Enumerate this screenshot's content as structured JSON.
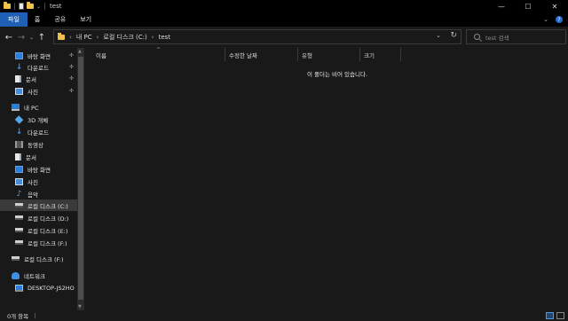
{
  "window": {
    "title": "test",
    "controls": {
      "minimize": "—",
      "maximize": "☐",
      "close": "✕"
    }
  },
  "ribbon": {
    "tabs": [
      {
        "label": "파일",
        "active": true
      },
      {
        "label": "홈",
        "active": false
      },
      {
        "label": "공유",
        "active": false
      },
      {
        "label": "보기",
        "active": false
      }
    ],
    "expand_icon": "⌄",
    "help_icon": "?"
  },
  "address": {
    "breadcrumb": [
      "내 PC",
      "로컬 디스크 (C:)",
      "test"
    ],
    "separator": "›",
    "dropdown_icon": "⌄",
    "refresh_icon": "↻"
  },
  "search": {
    "placeholder": "test 검색"
  },
  "nav": {
    "back_icon": "←",
    "forward_icon": "→",
    "recent_icon": "⌄",
    "up_icon": "↑",
    "items": [
      {
        "label": "바탕 화면",
        "icon": "desktop-icon",
        "pinned": true
      },
      {
        "label": "다운로드",
        "icon": "download-icon",
        "pinned": true
      },
      {
        "label": "문서",
        "icon": "document-icon",
        "pinned": true
      },
      {
        "label": "사진",
        "icon": "picture-icon",
        "pinned": true
      },
      {
        "label": "내 PC",
        "icon": "pc-icon",
        "pinned": false
      },
      {
        "label": "3D 개체",
        "icon": "3d-objects-icon",
        "pinned": false
      },
      {
        "label": "다운로드",
        "icon": "download-icon",
        "pinned": false
      },
      {
        "label": "동영상",
        "icon": "video-icon",
        "pinned": false
      },
      {
        "label": "문서",
        "icon": "document-icon",
        "pinned": false
      },
      {
        "label": "바탕 화면",
        "icon": "desktop-icon",
        "pinned": false
      },
      {
        "label": "사진",
        "icon": "picture-icon",
        "pinned": false
      },
      {
        "label": "음악",
        "icon": "music-icon",
        "pinned": false
      },
      {
        "label": "로컬 디스크 (C:)",
        "icon": "drive-icon",
        "pinned": false,
        "selected": true
      },
      {
        "label": "로컬 디스크 (D:)",
        "icon": "drive-icon",
        "pinned": false
      },
      {
        "label": "로컬 디스크 (E:)",
        "icon": "drive-icon",
        "pinned": false
      },
      {
        "label": "로컬 디스크 (F:)",
        "icon": "drive-icon",
        "pinned": false
      },
      {
        "label": "로컬 디스크 (F:)",
        "icon": "drive-icon",
        "pinned": false
      },
      {
        "label": "네트워크",
        "icon": "network-icon",
        "pinned": false
      },
      {
        "label": "DESKTOP-JS2HO",
        "icon": "computer-icon",
        "pinned": false
      }
    ],
    "pin_icon": "📌"
  },
  "columns": {
    "name": "이름",
    "modified": "수정한 날짜",
    "type": "유형",
    "size": "크기",
    "sort_icon": "^"
  },
  "content": {
    "empty_message": "이 폴더는 비어 있습니다."
  },
  "status": {
    "item_count": "0개 항목",
    "separator": "|"
  },
  "colors": {
    "background": "#191919",
    "titlebar": "#000000",
    "active_tab": "#1f5fb4",
    "folder": "#f0c14b",
    "selected_item": "#3a3a3a"
  }
}
